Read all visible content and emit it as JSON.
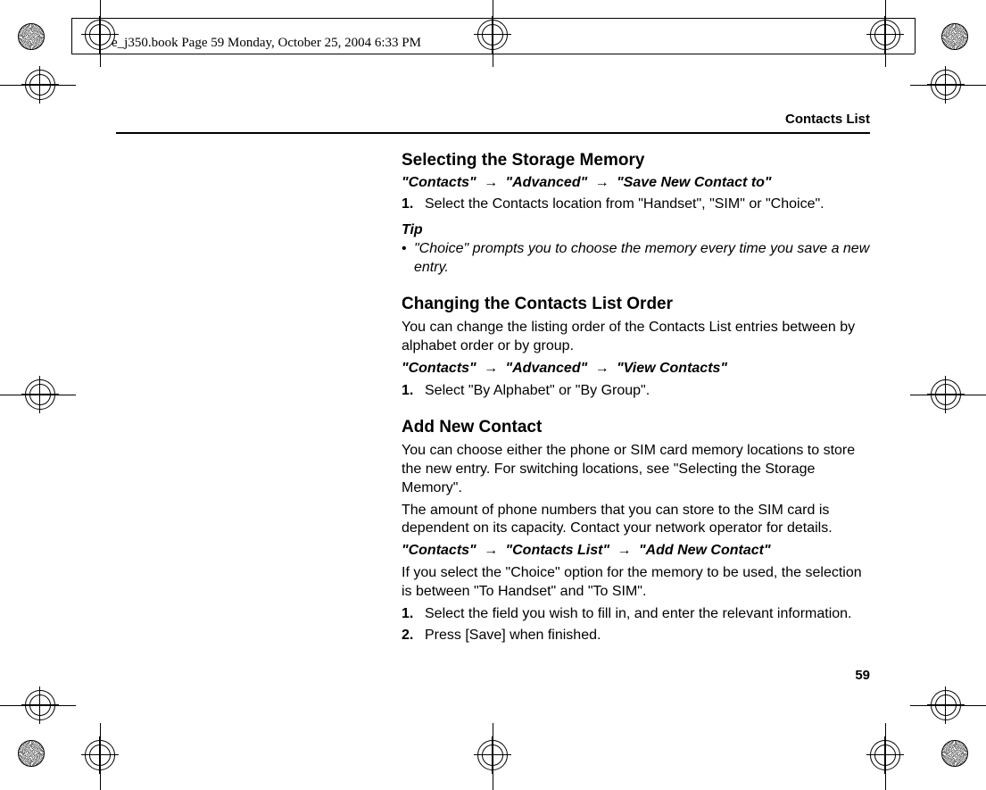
{
  "header": {
    "filedate": "e_j350.book  Page 59  Monday, October 25, 2004  6:33 PM"
  },
  "page": {
    "section_label": "Contacts List",
    "page_number": "59"
  },
  "sec1": {
    "heading": "Selecting the Storage Memory",
    "path_a": "\"Contacts\"",
    "path_b": "\"Advanced\"",
    "path_c": "\"Save New Contact to\"",
    "step1_num": "1.",
    "step1_text": "Select the Contacts location from \"Handset\", \"SIM\" or \"Choice\".",
    "tip_label": "Tip",
    "tip_bullet": "•",
    "tip_text": "\"Choice\" prompts you to choose the memory every time you save a new entry."
  },
  "sec2": {
    "heading": "Changing the Contacts List Order",
    "intro": "You can change the listing order of the Contacts List entries between by alphabet order or by group.",
    "path_a": "\"Contacts\"",
    "path_b": "\"Advanced\"",
    "path_c": "\"View Contacts\"",
    "step1_num": "1.",
    "step1_text": "Select \"By Alphabet\" or \"By Group\"."
  },
  "sec3": {
    "heading": "Add New Contact",
    "intro1": "You can choose either the phone or SIM card memory locations to store the new entry. For switching locations, see \"Selecting the Storage Memory\".",
    "intro2": "The amount of phone numbers that you can store to the SIM card is dependent on its capacity. Contact your network operator for details.",
    "path_a": "\"Contacts\"",
    "path_b": "\"Contacts List\"",
    "path_c": "\"Add New Contact\"",
    "intro3": "If you select the \"Choice\" option for the memory to be used, the selection is between \"To Handset\" and \"To SIM\".",
    "step1_num": "1.",
    "step1_text": "Select the field you wish to fill in, and enter the relevant information.",
    "step2_num": "2.",
    "step2_text": "Press [Save] when finished."
  },
  "arrow": "→"
}
